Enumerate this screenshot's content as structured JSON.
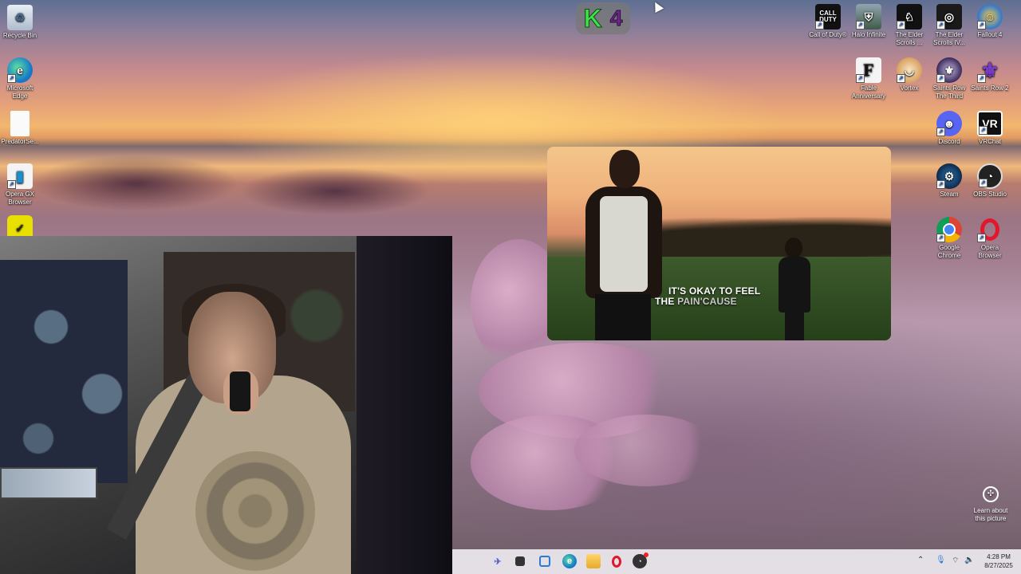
{
  "desktop": {
    "left_icons": [
      {
        "label": "Recycle Bin",
        "icon": "recycle-bin-icon"
      },
      {
        "label": "Microsoft Edge",
        "icon": "edge-icon"
      },
      {
        "label": "PredatorSe...",
        "icon": "file-icon"
      },
      {
        "label": "Opera GX Browser",
        "icon": "opera-gx-icon"
      },
      {
        "label": "",
        "icon": "checkmark-app-icon"
      }
    ],
    "right_icons": [
      {
        "label": "Call of Duty®",
        "icon": "call-of-duty-icon",
        "glyph": "CALL DUTY"
      },
      {
        "label": "Halo Infinite",
        "icon": "halo-infinite-icon"
      },
      {
        "label": "The Elder Scrolls ...",
        "icon": "elder-scrolls-icon"
      },
      {
        "label": "The Elder Scrolls IV...",
        "icon": "oblivion-icon"
      },
      {
        "label": "Fallout 4",
        "icon": "fallout-4-icon"
      },
      {
        "label": "Fable Anniversary",
        "icon": "fable-icon",
        "glyph": "F"
      },
      {
        "label": "Vortex",
        "icon": "vortex-icon"
      },
      {
        "label": "Saints Row The Third",
        "icon": "saints-row-third-icon"
      },
      {
        "label": "Saints Row 2",
        "icon": "saints-row-2-icon"
      },
      {
        "label": "Discord",
        "icon": "discord-icon"
      },
      {
        "label": "VRChat",
        "icon": "vrchat-icon",
        "glyph": "VR"
      },
      {
        "label": "Steam",
        "icon": "steam-icon"
      },
      {
        "label": "OBS Studio",
        "icon": "obs-icon"
      },
      {
        "label": "Google Chrome",
        "icon": "chrome-icon"
      },
      {
        "label": "Opera Browser",
        "icon": "opera-icon"
      }
    ],
    "learn_label": "Learn about this picture"
  },
  "overlay": {
    "score_letter": "K",
    "score_value": "4"
  },
  "video": {
    "lyric_line1": "IT'S OKAY TO FEEL",
    "lyric_line2_a": "THE ",
    "lyric_line2_b": "PAIN'CAUSE"
  },
  "taskbar": {
    "time": "4:28 PM",
    "date": "8/27/2025"
  },
  "colors": {
    "score_k": "#3ee04b",
    "score_n": "#6d2a8a",
    "taskbar_bg": "#eeeaf0"
  }
}
